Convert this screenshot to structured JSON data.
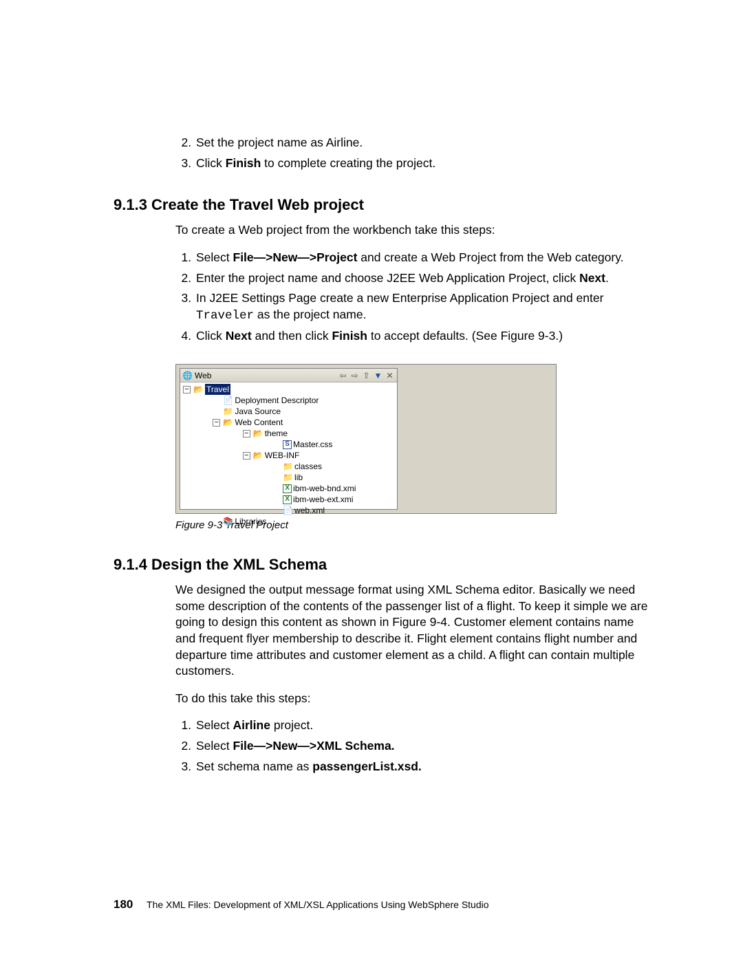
{
  "topList": {
    "start": 2,
    "items": [
      {
        "parts": [
          {
            "t": "Set the project name as Airline."
          }
        ]
      },
      {
        "parts": [
          {
            "t": "Click "
          },
          {
            "t": "Finish",
            "b": true
          },
          {
            "t": " to complete creating the project."
          }
        ]
      }
    ]
  },
  "section913": {
    "heading": "9.1.3  Create the Travel Web project",
    "intro": "To create a Web project from the workbench take this steps:",
    "items": [
      {
        "parts": [
          {
            "t": "Select "
          },
          {
            "t": "File—>New—>Project",
            "b": true
          },
          {
            "t": " and create a Web Project from the Web category."
          }
        ]
      },
      {
        "parts": [
          {
            "t": "Enter the project name and choose J2EE Web Application Project, click "
          },
          {
            "t": "Next",
            "b": true
          },
          {
            "t": "."
          }
        ]
      },
      {
        "parts": [
          {
            "t": "In J2EE Settings Page create a new Enterprise Application Project and enter "
          },
          {
            "t": "Traveler",
            "m": true
          },
          {
            "t": " as the project name."
          }
        ]
      },
      {
        "parts": [
          {
            "t": "Click "
          },
          {
            "t": "Next",
            "b": true
          },
          {
            "t": " and then click "
          },
          {
            "t": "Finish",
            "b": true
          },
          {
            "t": " to accept defaults. (See Figure 9-3.)"
          }
        ]
      }
    ],
    "figCaption": "Figure 9-3   Travel Project"
  },
  "webPane": {
    "title": "Web",
    "tree": [
      {
        "indent": "",
        "exp": "-",
        "icon": "folder-open",
        "label": "Travel",
        "selected": true
      },
      {
        "indent": "   ",
        "exp": "",
        "icon": "dd",
        "label": "Deployment Descriptor"
      },
      {
        "indent": "   ",
        "exp": "",
        "icon": "folder-closed",
        "label": "Java Source"
      },
      {
        "indent": "   ",
        "exp": "-",
        "icon": "folder-open",
        "label": "Web Content"
      },
      {
        "indent": "      ",
        "exp": "-",
        "icon": "folder-open",
        "label": "theme"
      },
      {
        "indent": "         ",
        "exp": "",
        "icon": "stylesheet",
        "label": "Master.css"
      },
      {
        "indent": "      ",
        "exp": "-",
        "icon": "folder-open",
        "label": "WEB-INF"
      },
      {
        "indent": "         ",
        "exp": "",
        "icon": "folder-closed",
        "label": "classes"
      },
      {
        "indent": "         ",
        "exp": "",
        "icon": "folder-closed",
        "label": "lib"
      },
      {
        "indent": "         ",
        "exp": "",
        "icon": "xml",
        "label": "ibm-web-bnd.xmi"
      },
      {
        "indent": "         ",
        "exp": "",
        "icon": "xml",
        "label": "ibm-web-ext.xmi"
      },
      {
        "indent": "         ",
        "exp": "",
        "icon": "webxml",
        "label": "web.xml"
      },
      {
        "indent": "   ",
        "exp": "",
        "icon": "lib",
        "label": "Libraries"
      }
    ]
  },
  "section914": {
    "heading": "9.1.4  Design the XML Schema",
    "para1": "We designed the output message format using XML Schema editor. Basically we need some description of the contents of the passenger list of a flight. To keep it simple we are going to design this content as shown in Figure 9-4. Customer element contains name and frequent flyer membership to describe it. Flight element contains flight number and departure time attributes and customer element as a child. A flight can contain multiple customers.",
    "para2": "To do this take this steps:",
    "items": [
      {
        "parts": [
          {
            "t": "Select "
          },
          {
            "t": "Airline",
            "b": true
          },
          {
            "t": " project."
          }
        ]
      },
      {
        "parts": [
          {
            "t": "Select "
          },
          {
            "t": "File—>New—>XML Schema.",
            "b": true
          }
        ]
      },
      {
        "parts": [
          {
            "t": "Set schema name as "
          },
          {
            "t": "passengerList.xsd.",
            "b": true
          }
        ]
      }
    ]
  },
  "footer": {
    "page": "180",
    "text": "The XML Files:  Development of XML/XSL Applications Using WebSphere Studio"
  }
}
